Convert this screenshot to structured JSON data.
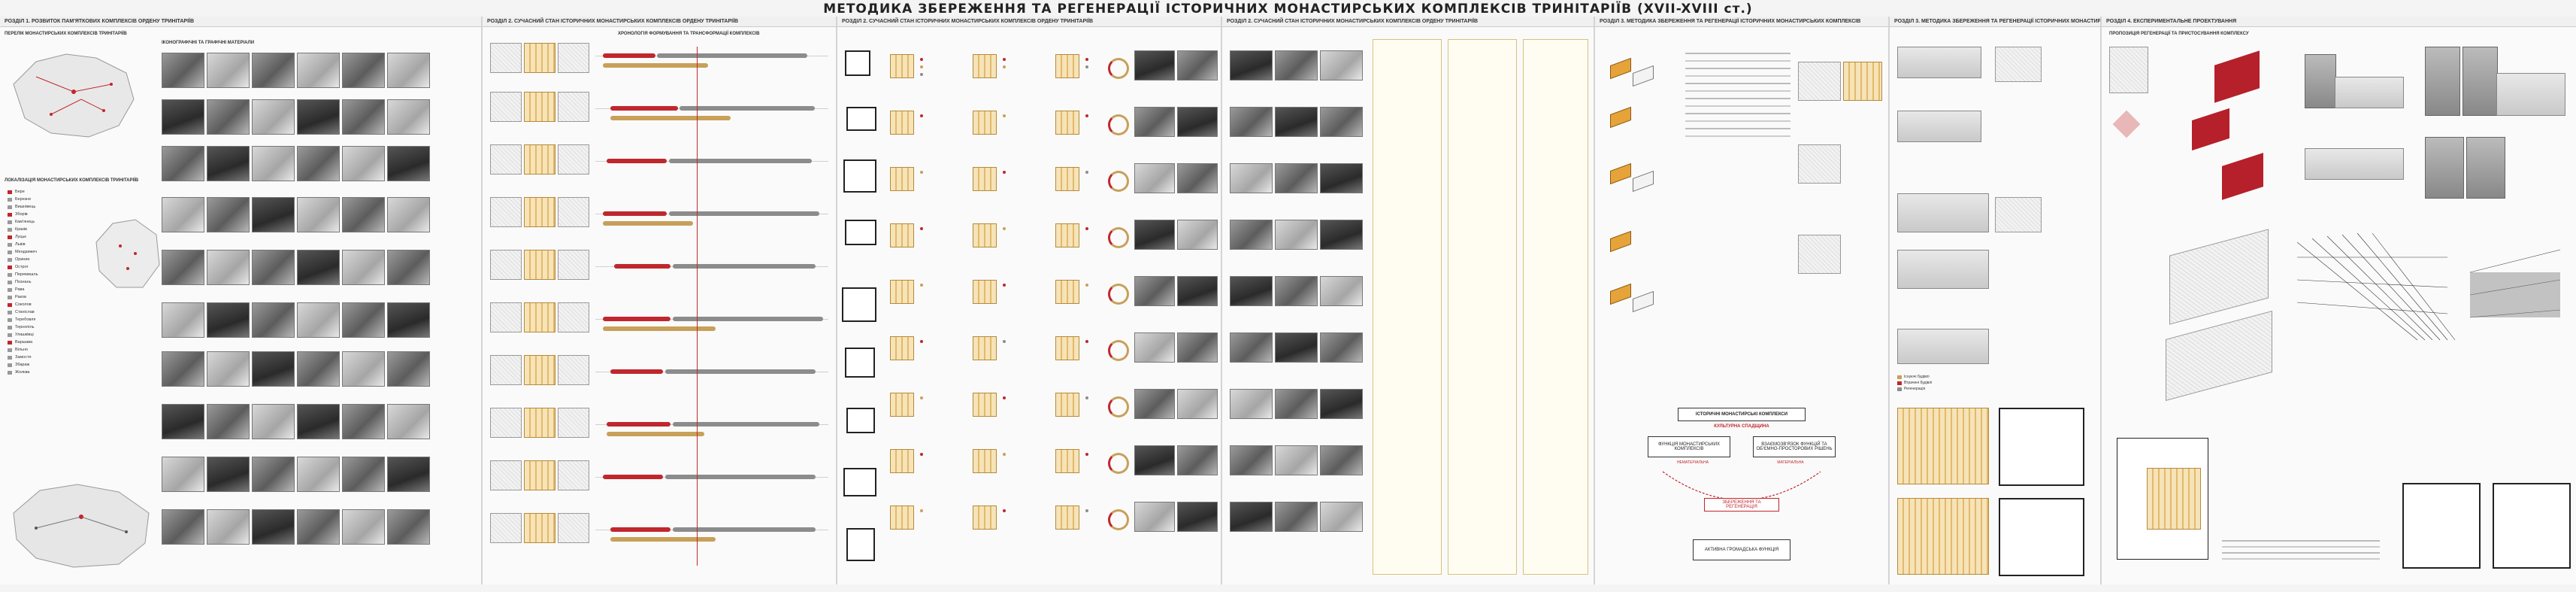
{
  "title": "МЕТОДИКА ЗБЕРЕЖЕННЯ ТА РЕГЕНЕРАЦІЇ ІСТОРИЧНИХ МОНАСТИРСЬКИХ КОМПЛЕКСІВ ТРИНІТАРІЇВ (XVII-XVIII ст.)",
  "sections": [
    {
      "label": "РОЗДІЛ 1. РОЗВИТОК ПАМ'ЯТКОВИХ КОМПЛЕКСІВ ОРДЕНУ ТРИНІТАРІЇВ"
    },
    {
      "label": "РОЗДІЛ 2. СУЧАСНИЙ СТАН ІСТОРИЧНИХ МОНАСТИРСЬКИХ КОМПЛЕКСІВ ОРДЕНУ ТРИНІТАРІЇВ"
    },
    {
      "label": "РОЗДІЛ 3. МЕТОДИКА ЗБЕРЕЖЕННЯ ТА РЕГЕНЕРАЦІЇ ІСТОРИЧНИХ МОНАСТИРСЬКИХ КОМПЛЕКСІВ"
    },
    {
      "label": "РОЗДІЛ 4. ЕКСПЕРИМЕНТАЛЬНЕ ПРОЕКТУВАННЯ"
    }
  ],
  "subtitles": {
    "p1_map": "ПЕРЕЛІК МОНАСТИРСЬКИХ КОМПЛЕКСІВ ТРИНІТАРІЇВ",
    "p1_list": "ЛОКАЛІЗАЦІЯ МОНАСТИРСЬКИХ КОМПЛЕКСІВ ТРИНІТАРІЇВ",
    "p1_photos": "ІКОНОГРАФІЧНІ ТА ГРАФІЧНІ МАТЕРІАЛИ",
    "p2_timeline": "ХРОНОЛОГІЯ ФОРМУВАННЯ ТА ТРАНСФОРМАЦІЇ КОМПЛЕКСІВ",
    "p4_scheme": "ІСТОРИЧНІ МОНАСТИРСЬКІ КОМПЛЕКСИ",
    "p5_proposal": "ПРОПОЗИЦІЯ РЕГЕНЕРАЦІЇ ТА ПРИСТОСУВАННЯ КОМПЛЕКСУ"
  },
  "cities": [
    "Бере",
    "Березне",
    "Вишнівець",
    "Зборів",
    "Кам'янець",
    "Краків",
    "Луцьк",
    "Львів",
    "Мендзижеч",
    "Оринин",
    "Острог",
    "Перемишль",
    "Познань",
    "Рава",
    "Раков",
    "Соколов",
    "Станіслав",
    "Теребовля",
    "Тернопіль",
    "Улашківці",
    "Варшава",
    "Вільно",
    "Замостя",
    "Збараж",
    "Жолква"
  ],
  "scheme": {
    "center": "ІСТОРИЧНІ МОНАСТИРСЬКІ КОМПЛЕКСИ",
    "left": "ФУНКЦІЯ МОНАСТИРСЬКИХ КОМПЛЕКСІВ",
    "right": "ВЗАЄМОЗВ'ЯЗОК ФУНКЦІЙ ТА ОБ'ЄМНО-ПРОСТОРОВИХ РІШЕНЬ",
    "mid": "ЗБЕРЕЖЕННЯ ТА РЕГЕНЕРАЦІЯ",
    "bottom": "АКТИВНА ГРОМАДСЬКА ФУНКЦІЯ",
    "tag_red": "КУЛЬТУРНА СПАДЩИНА",
    "tag_a": "НЕМАТЕРІАЛЬНА",
    "tag_b": "МАТЕРІАЛЬНА"
  },
  "legend": [
    {
      "label": "Існуючі будівлі",
      "color": "#c8a05a"
    },
    {
      "label": "Втрачені будівлі",
      "color": "#c0272d"
    },
    {
      "label": "Регенерація",
      "color": "#8c8c8c"
    }
  ],
  "colors": {
    "accent": "#c0272d",
    "ochre": "#c8a05a",
    "grey": "#8c8c8c"
  }
}
